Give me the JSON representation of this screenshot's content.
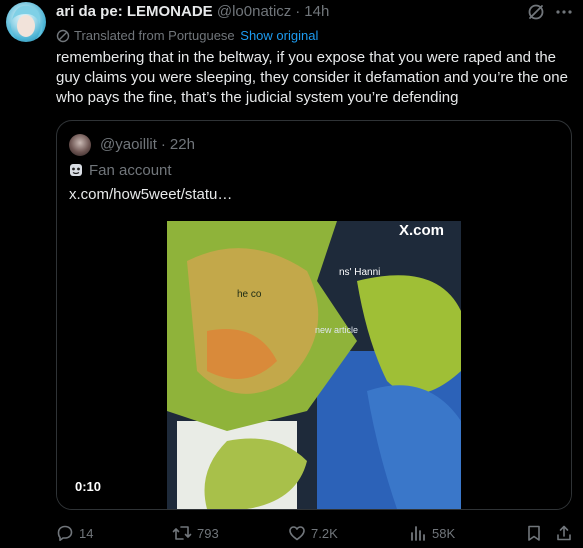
{
  "tweet": {
    "display_name": "ari da pe: LEMONADE",
    "handle": "@lo0naticz",
    "time": "14h",
    "translated_label": "Translated from Portuguese",
    "show_original": "Show original",
    "text": "remembering that in the beltway, if you expose that you were raped and the guy claims you were sleeping, they consider it defamation and you’re the one who pays the fine, that’s the judicial system you’re defending"
  },
  "quote": {
    "handle": "@yaoillit",
    "time": "22h",
    "label": "Fan account",
    "link": "x.com/how5weet/statu…",
    "video": {
      "duration": "0:10",
      "watermark": "X.com",
      "overlay_text_1": "ns' Hanni",
      "overlay_text_2": "he co",
      "overlay_text_3": "new article"
    }
  },
  "actions": {
    "replies": "14",
    "reposts": "793",
    "likes": "7.2K",
    "views": "58K"
  },
  "colors": {
    "background": "#000000",
    "text_primary": "#e7e9ea",
    "text_secondary": "#71767b",
    "link": "#1d9bf0",
    "border": "#2f3336"
  },
  "icons": [
    "grok-icon",
    "more-icon",
    "translate-icon",
    "mask-icon",
    "reply-icon",
    "repost-icon",
    "like-icon",
    "views-icon",
    "bookmark-icon",
    "share-icon"
  ]
}
